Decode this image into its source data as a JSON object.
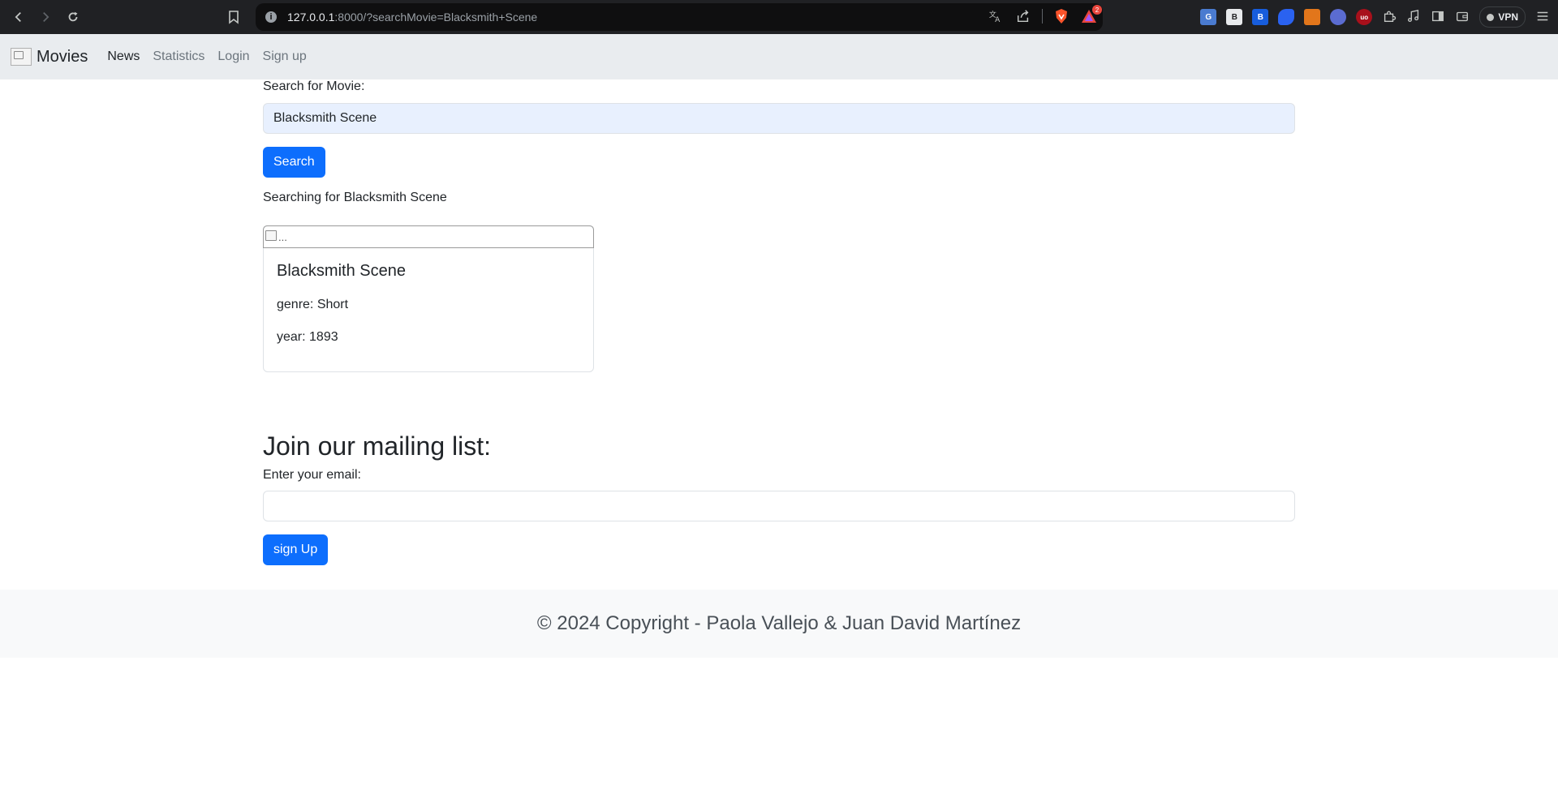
{
  "browser": {
    "url_host": "127.0.0.1",
    "url_rest": ":8000/?searchMovie=Blacksmith+Scene",
    "notification_count": "2",
    "vpn_label": "VPN",
    "extensions": [
      {
        "name": "translate-extension-icon",
        "text": "G",
        "color": "#4a7bd0"
      },
      {
        "name": "bookmark-b-extension-icon",
        "text": "B",
        "color": "#e8eaed"
      },
      {
        "name": "bitwarden-extension-icon",
        "text": "B",
        "color": "#175ddc"
      },
      {
        "name": "blue-shield-extension-icon",
        "text": "",
        "color": "#2a62f0"
      },
      {
        "name": "metamask-extension-icon",
        "text": "",
        "color": "#e2761b"
      },
      {
        "name": "sync-extension-icon",
        "text": "",
        "color": "#5b6cd1"
      },
      {
        "name": "ublock-extension-icon",
        "text": "uo",
        "color": "#a8101b"
      }
    ]
  },
  "navbar": {
    "brand": "Movies",
    "links": [
      {
        "label": "News",
        "active": true
      },
      {
        "label": "Statistics",
        "active": false
      },
      {
        "label": "Login",
        "active": false
      },
      {
        "label": "Sign up",
        "active": false
      }
    ]
  },
  "search": {
    "label": "Search for Movie:",
    "value": "Blacksmith Scene",
    "button": "Search",
    "status": "Searching for Blacksmith Scene"
  },
  "result_card": {
    "img_alt": "...",
    "title": "Blacksmith Scene",
    "genre": "genre: Short",
    "year": "year: 1893"
  },
  "mailing": {
    "heading": "Join our mailing list:",
    "label": "Enter your email:",
    "value": "",
    "button": "sign Up"
  },
  "footer": {
    "text": "© 2024 Copyright - Paola Vallejo & Juan David Martínez"
  }
}
